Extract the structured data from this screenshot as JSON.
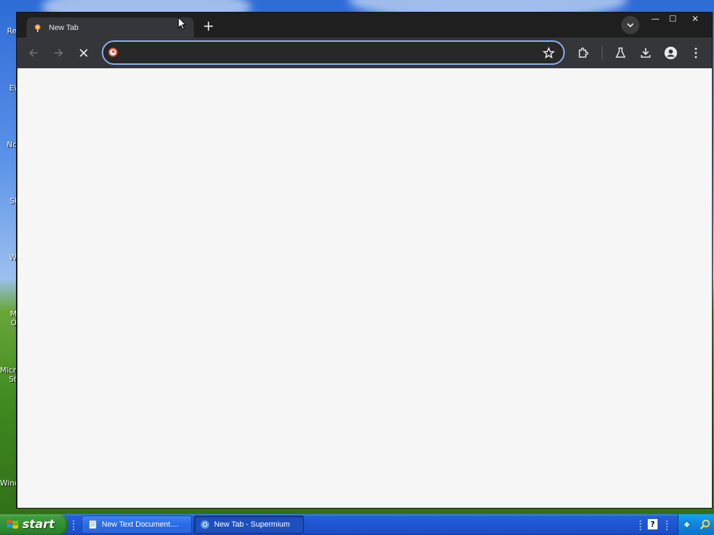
{
  "desktop": {
    "icon_labels": [
      "Re",
      "E\\",
      "Nc",
      "Sl",
      "W",
      "M",
      "O",
      "Micro",
      "St",
      "Wind"
    ]
  },
  "browser": {
    "tab": {
      "title": "New Tab",
      "favicon": "supermium-icon"
    },
    "new_tab_label": "+",
    "window_controls": {
      "minimize": "—",
      "maximize": "☐",
      "close": "✕"
    },
    "toolbar": {
      "back": "back-arrow-icon",
      "forward": "forward-arrow-icon",
      "stop": "stop-icon",
      "omnibox_value": "",
      "bookmark": "star-icon",
      "extensions": "puzzle-icon",
      "labs": "flask-icon",
      "downloads": "download-icon",
      "profile": "profile-icon",
      "menu": "kebab-menu-icon"
    },
    "accent": "#8ab4f8"
  },
  "taskbar": {
    "start_label": "start",
    "tasks": [
      {
        "label": "New Text Document....",
        "active": false,
        "icon": "notepad-icon"
      },
      {
        "label": "New Tab - Supermium",
        "active": true,
        "icon": "supermium-icon"
      }
    ],
    "help_icon": "?"
  }
}
